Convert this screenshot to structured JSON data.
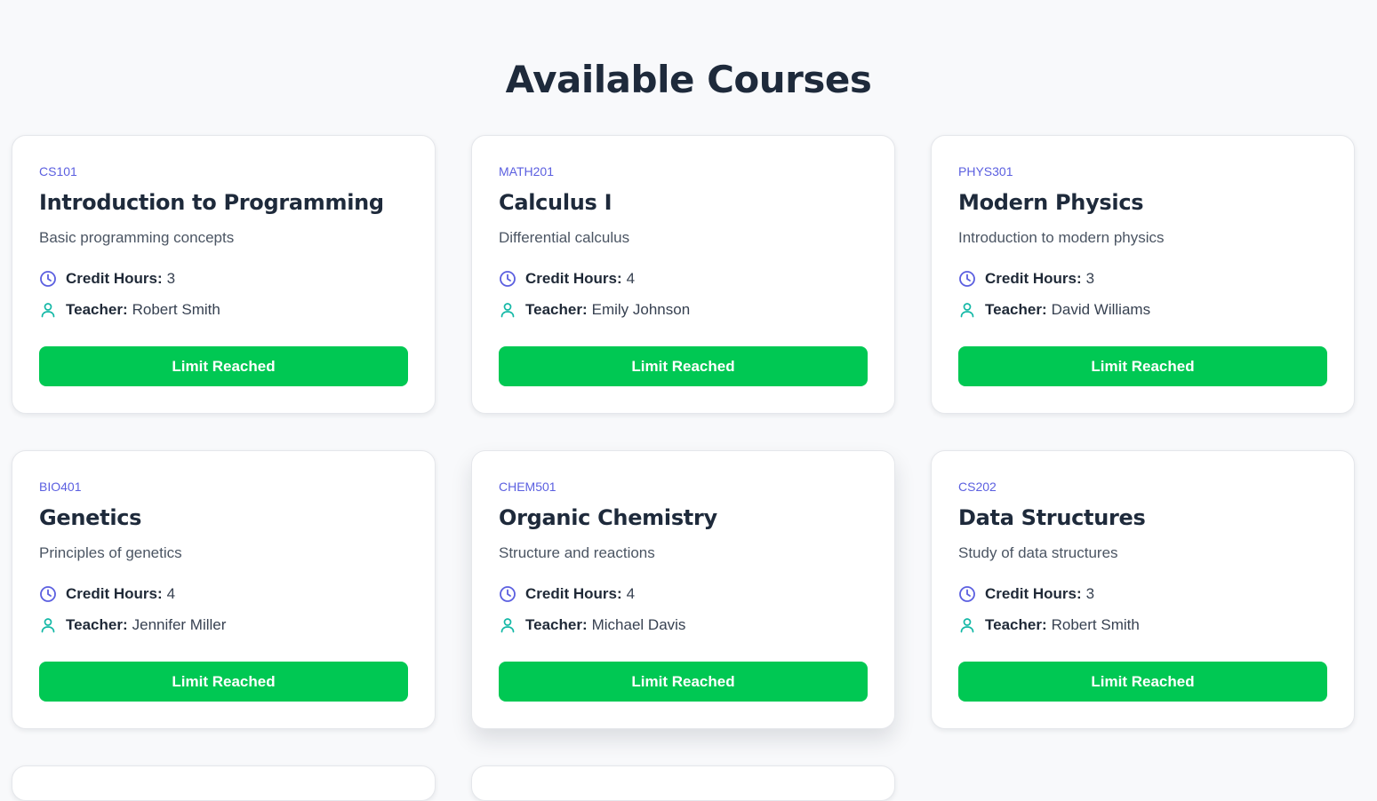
{
  "page": {
    "title": "Available Courses"
  },
  "labels": {
    "credit_hours": "Credit Hours:",
    "teacher": "Teacher:"
  },
  "colors": {
    "accent": "#5b5fe0",
    "button": "#00c853",
    "teacher_icon": "#14b8a6"
  },
  "icons": {
    "credit_hours": "clock-icon",
    "teacher": "user-icon"
  },
  "courses": [
    {
      "code": "CS101",
      "title": "Introduction to Programming",
      "description": "Basic programming concepts",
      "credit_hours": "3",
      "teacher": "Robert Smith",
      "button_label": "Limit Reached"
    },
    {
      "code": "MATH201",
      "title": "Calculus I",
      "description": "Differential calculus",
      "credit_hours": "4",
      "teacher": "Emily Johnson",
      "button_label": "Limit Reached"
    },
    {
      "code": "PHYS301",
      "title": "Modern Physics",
      "description": "Introduction to modern physics",
      "credit_hours": "3",
      "teacher": "David Williams",
      "button_label": "Limit Reached"
    },
    {
      "code": "BIO401",
      "title": "Genetics",
      "description": "Principles of genetics",
      "credit_hours": "4",
      "teacher": "Jennifer Miller",
      "button_label": "Limit Reached"
    },
    {
      "code": "CHEM501",
      "title": "Organic Chemistry",
      "description": "Structure and reactions",
      "credit_hours": "4",
      "teacher": "Michael Davis",
      "button_label": "Limit Reached"
    },
    {
      "code": "CS202",
      "title": "Data Structures",
      "description": "Study of data structures",
      "credit_hours": "3",
      "teacher": "Robert Smith",
      "button_label": "Limit Reached"
    }
  ]
}
